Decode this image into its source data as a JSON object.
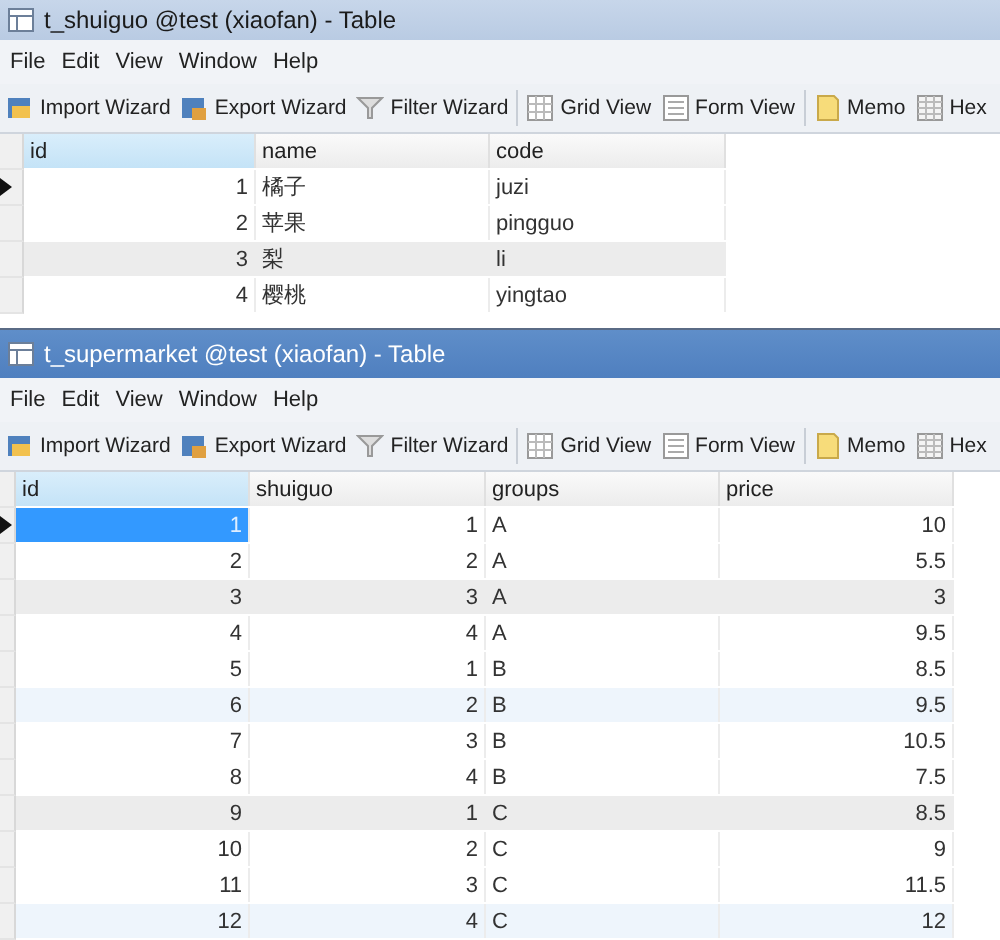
{
  "windows": [
    {
      "title": "t_shuiguo @test (xiaofan) - Table",
      "menu": [
        "File",
        "Edit",
        "View",
        "Window",
        "Help"
      ],
      "toolbar": [
        {
          "label": "Import Wizard",
          "kind": "import"
        },
        {
          "label": "Export Wizard",
          "kind": "export"
        },
        {
          "label": "Filter Wizard",
          "kind": "filter"
        },
        {
          "label": "Grid View",
          "kind": "grid"
        },
        {
          "label": "Form View",
          "kind": "form"
        },
        {
          "label": "Memo",
          "kind": "memo"
        },
        {
          "label": "Hex",
          "kind": "hex"
        }
      ],
      "table": {
        "columns": [
          "id",
          "name",
          "code"
        ],
        "rows": [
          {
            "cells": [
              "1",
              "橘子",
              "juzi"
            ],
            "selected": true
          },
          {
            "cells": [
              "2",
              "苹果",
              "pingguo"
            ],
            "selected": false
          },
          {
            "cells": [
              "3",
              "梨",
              "li"
            ],
            "selected": false
          },
          {
            "cells": [
              "4",
              "樱桃",
              "yingtao"
            ],
            "selected": false
          }
        ]
      }
    },
    {
      "title": "t_supermarket @test (xiaofan) - Table",
      "menu": [
        "File",
        "Edit",
        "View",
        "Window",
        "Help"
      ],
      "toolbar": [
        {
          "label": "Import Wizard",
          "kind": "import"
        },
        {
          "label": "Export Wizard",
          "kind": "export"
        },
        {
          "label": "Filter Wizard",
          "kind": "filter"
        },
        {
          "label": "Grid View",
          "kind": "grid"
        },
        {
          "label": "Form View",
          "kind": "form"
        },
        {
          "label": "Memo",
          "kind": "memo"
        },
        {
          "label": "Hex",
          "kind": "hex"
        }
      ],
      "table": {
        "columns": [
          "id",
          "shuiguo",
          "groups",
          "price"
        ],
        "rows": [
          {
            "cells": [
              "1",
              "1",
              "A",
              "10"
            ],
            "selected": true
          },
          {
            "cells": [
              "2",
              "2",
              "A",
              "5.5"
            ],
            "selected": false
          },
          {
            "cells": [
              "3",
              "3",
              "A",
              "3"
            ],
            "selected": false
          },
          {
            "cells": [
              "4",
              "4",
              "A",
              "9.5"
            ],
            "selected": false
          },
          {
            "cells": [
              "5",
              "1",
              "B",
              "8.5"
            ],
            "selected": false
          },
          {
            "cells": [
              "6",
              "2",
              "B",
              "9.5"
            ],
            "selected": false
          },
          {
            "cells": [
              "7",
              "3",
              "B",
              "10.5"
            ],
            "selected": false
          },
          {
            "cells": [
              "8",
              "4",
              "B",
              "7.5"
            ],
            "selected": false
          },
          {
            "cells": [
              "9",
              "1",
              "C",
              "8.5"
            ],
            "selected": false
          },
          {
            "cells": [
              "10",
              "2",
              "C",
              "9"
            ],
            "selected": false
          },
          {
            "cells": [
              "11",
              "3",
              "C",
              "11.5"
            ],
            "selected": false
          },
          {
            "cells": [
              "12",
              "4",
              "C",
              "12"
            ],
            "selected": false
          }
        ]
      }
    }
  ]
}
